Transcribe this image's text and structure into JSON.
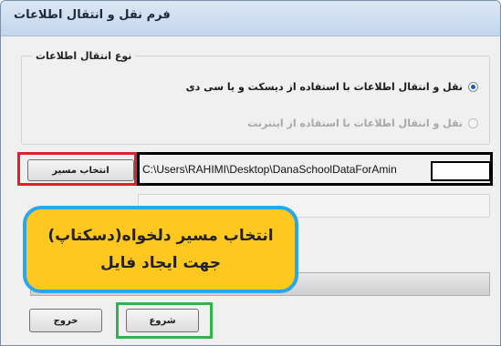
{
  "window": {
    "title": "فرم نقل و انتقال اطلاعات"
  },
  "transfer_group": {
    "legend": "نوع انتقال اطلاعات",
    "options": [
      {
        "label": "نقل و انتقال اطلاعات با استفاده از دیسکت و یا سی دی",
        "selected": true,
        "enabled": true
      },
      {
        "label": "نقل و انتقال اطلاعات با استفاده از اینترنت",
        "selected": false,
        "enabled": false
      }
    ]
  },
  "path": {
    "browse_label": "انتخاب مسیر",
    "value": "C:\\Users\\RAHIMI\\Desktop\\DanaSchoolDataForAmin"
  },
  "callout": {
    "line1": "انتخاب مسیر دلخواه(دسکتاپ)",
    "line2": "جهت ایجاد فایل"
  },
  "buttons": {
    "exit_label": "خروج",
    "start_label": "شروع"
  },
  "colors": {
    "annotation_red": "#e0202a",
    "annotation_green": "#2fb34a",
    "annotation_black": "#000000",
    "callout_fill": "#ffc820",
    "callout_border": "#2aa7e6"
  }
}
